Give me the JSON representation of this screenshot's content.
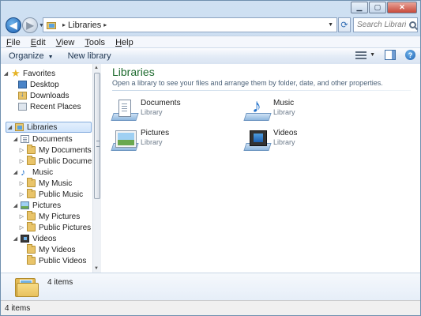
{
  "address": {
    "segment": "Libraries",
    "chevron": "▸"
  },
  "search": {
    "placeholder": "Search Libraries"
  },
  "menu": [
    "File",
    "Edit",
    "View",
    "Tools",
    "Help"
  ],
  "toolbar": {
    "organize": "Organize",
    "new_library": "New library"
  },
  "nav": {
    "favorites": {
      "label": "Favorites",
      "items": [
        "Desktop",
        "Downloads",
        "Recent Places"
      ]
    },
    "libraries": {
      "label": "Libraries",
      "groups": [
        {
          "label": "Documents",
          "children": [
            "My Documents",
            "Public Documents"
          ]
        },
        {
          "label": "Music",
          "children": [
            "My Music",
            "Public Music"
          ]
        },
        {
          "label": "Pictures",
          "children": [
            "My Pictures",
            "Public Pictures"
          ]
        },
        {
          "label": "Videos",
          "children": [
            "My Videos",
            "Public Videos"
          ]
        }
      ]
    }
  },
  "content": {
    "title": "Libraries",
    "subtitle": "Open a library to see your files and arrange them by folder, date, and other properties.",
    "libraries": [
      {
        "name": "Documents",
        "type": "Library",
        "icon": "documents-library-icon"
      },
      {
        "name": "Music",
        "type": "Library",
        "icon": "music-library-icon"
      },
      {
        "name": "Pictures",
        "type": "Library",
        "icon": "pictures-library-icon"
      },
      {
        "name": "Videos",
        "type": "Library",
        "icon": "videos-library-icon"
      }
    ]
  },
  "details": {
    "count": "4 items"
  },
  "status": {
    "count": "4 items"
  },
  "colors": {
    "title_green": "#1e6b2f",
    "selection_blue": "#cfe3fb",
    "chrome_blue": "#bcd3ec"
  }
}
